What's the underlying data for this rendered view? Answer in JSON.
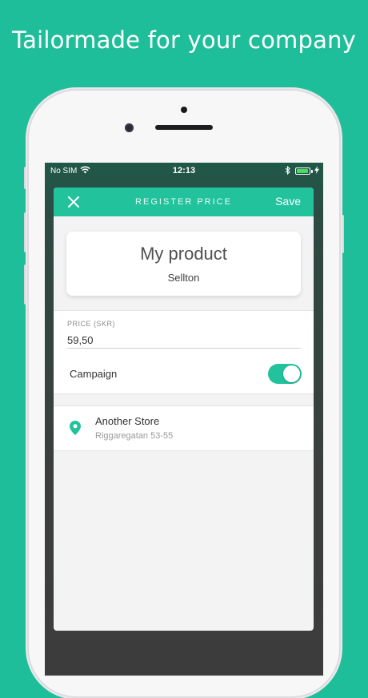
{
  "headline": "Tailormade for your company",
  "status_bar": {
    "carrier": "No SIM",
    "time": "12:13",
    "wifi_icon": "wifi-icon",
    "bluetooth_icon": "bluetooth-icon",
    "battery_icon": "battery-icon"
  },
  "header": {
    "title": "REGISTER PRICE",
    "close_icon": "close-icon",
    "save_label": "Save"
  },
  "product": {
    "name": "My product",
    "store": "Sellton"
  },
  "form": {
    "price_label": "PRICE (SKR)",
    "price_value": "59,50",
    "campaign_label": "Campaign",
    "campaign_enabled": true
  },
  "store": {
    "icon": "location-pin-icon",
    "name": "Another Store",
    "address": "Riggaregatan 53-55"
  },
  "colors": {
    "brand_green": "#1fbe9a",
    "header_green": "#22c29d"
  }
}
